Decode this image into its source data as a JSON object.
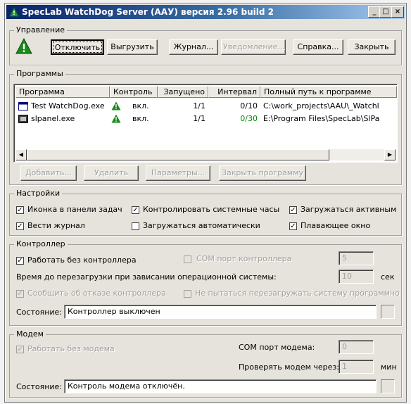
{
  "window": {
    "title": "SpecLab WatchDog Server (AAУ) версия 2.96 build 2",
    "buttons": {
      "minimize": "_",
      "maximize": "□",
      "close": "×"
    }
  },
  "control": {
    "group_label": "Управление",
    "buttons": {
      "disable": "Отключить",
      "unload": "Выгрузить",
      "log": "Журнал...",
      "notification": "Уведомление...",
      "help": "Справка...",
      "close": "Закрыть"
    }
  },
  "programs": {
    "group_label": "Программы",
    "columns": [
      "Программа",
      "Контроль",
      "Запущено",
      "Интервал",
      "Полный путь к программе"
    ],
    "rows": [
      {
        "name": "Test WatchDog.exe",
        "control": "вкл.",
        "started": "1/1",
        "interval": "0/10",
        "path": "C:\\work_projects\\AAU\\_Watchl"
      },
      {
        "name": "slpanel.exe",
        "control": "вкл.",
        "started": "1/1",
        "interval": "0/30",
        "path": "E:\\Program Files\\SpecLab\\SlPa"
      }
    ],
    "buttons": {
      "add": "Добавить...",
      "delete": "Удалить",
      "params": "Параметры...",
      "close_program": "Закрыть программу"
    }
  },
  "settings": {
    "group_label": "Настройки",
    "options": {
      "tray_icon": "Иконка в панели задач",
      "monitor_clock": "Контролировать системные часы",
      "load_active": "Загружаться активным",
      "keep_log": "Вести журнал",
      "autoload": "Загружаться автоматически",
      "floating": "Плавающее окно"
    }
  },
  "controller": {
    "group_label": "Контроллер",
    "work_without": "Работать без контроллера",
    "com_port_label": "СОМ порт контроллера",
    "com_port_value": "5",
    "reboot_label": "Время до перезагрузки при зависании операционной системы:",
    "reboot_value": "10",
    "reboot_unit": "сек",
    "report_failure": "Сообщить об отказе контроллера",
    "no_reboot": "Не пытаться перезагружать систему программно",
    "state_label": "Состояние:",
    "state_value": "Контроллер выключен"
  },
  "modem": {
    "group_label": "Модем",
    "work_without": "Работать без модема",
    "com_port_label": "СОМ порт модема:",
    "com_port_value": "0",
    "check_label": "Проверять модем через:",
    "check_value": "1",
    "check_unit": "мин",
    "state_label": "Состояние:",
    "state_value": "Контроль модема отключён."
  },
  "colors": {
    "status_green": "#1a8a1a",
    "title_blue": "#0a246a",
    "interval_green": "#008000"
  }
}
